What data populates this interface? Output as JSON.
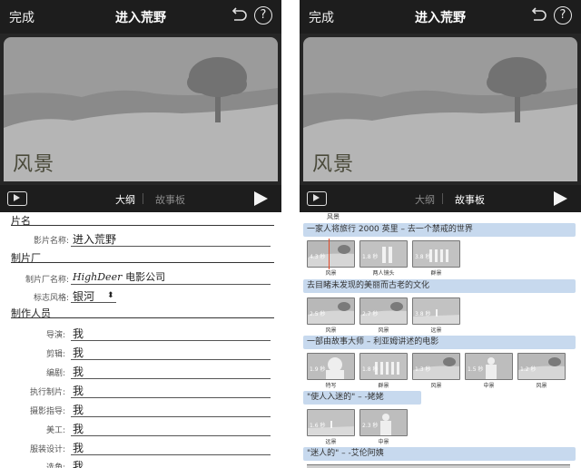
{
  "left": {
    "topbar": {
      "done": "完成",
      "title": "进入荒野",
      "help": "?"
    },
    "preview": {
      "scene_title": "风景"
    },
    "controlbar": {
      "tab_outline": "大纲",
      "tab_storyboard": "故事板"
    },
    "sections": {
      "title": "片名",
      "studio": "制片厂",
      "crew": "制作人员"
    },
    "fields": {
      "movie_name_label": "影片名称:",
      "movie_name_value": "进入荒野",
      "studio_name_label": "制片厂名称:",
      "studio_script": "HighDeer",
      "studio_suffix": "电影公司",
      "logo_label": "标志风格:",
      "logo_value": "银河",
      "crew": [
        {
          "label": "导演:",
          "value": "我"
        },
        {
          "label": "剪辑:",
          "value": "我"
        },
        {
          "label": "编剧:",
          "value": "我"
        },
        {
          "label": "执行制片:",
          "value": "我"
        },
        {
          "label": "摄影指导:",
          "value": "我"
        },
        {
          "label": "美工:",
          "value": "我"
        },
        {
          "label": "服装设计:",
          "value": "我"
        },
        {
          "label": "选角:",
          "value": "我"
        }
      ]
    }
  },
  "right": {
    "topbar": {
      "done": "完成",
      "title": "进入荒野",
      "help": "?"
    },
    "preview": {
      "scene_title": "风景"
    },
    "controlbar": {
      "tab_outline": "大纲",
      "tab_storyboard": "故事板"
    },
    "top_label": "风景",
    "groups": [
      {
        "heading": "一家人将旅行 2000 英里 – 去一个禁戒的世界",
        "clips": [
          {
            "duration": "4.3 秒",
            "label": "风景"
          },
          {
            "duration": "1.8 秒",
            "label": "两人镜头"
          },
          {
            "duration": "3.8 秒",
            "label": "群景"
          }
        ]
      },
      {
        "heading": "去目睹未发现的美丽而古老的文化",
        "clips": [
          {
            "duration": "2.5 秒",
            "label": "风景"
          },
          {
            "duration": "2.7 秒",
            "label": "风景"
          },
          {
            "duration": "3.8 秒",
            "label": "远景"
          }
        ]
      },
      {
        "heading": "一部由故事大师 – 利亚姆讲述的电影",
        "clips": [
          {
            "duration": "1.9 秒",
            "label": "特写"
          },
          {
            "duration": "1.8 秒",
            "label": "群景"
          },
          {
            "duration": "1.3 秒",
            "label": "风景"
          },
          {
            "duration": "1.5 秒",
            "label": "中景"
          },
          {
            "duration": "1.2 秒",
            "label": "风景"
          }
        ]
      },
      {
        "heading": "\"使人入迷的\" – -姥姥",
        "clips": [
          {
            "duration": "1.6 秒",
            "label": "远景"
          },
          {
            "duration": "2.3 秒",
            "label": "中景"
          }
        ]
      },
      {
        "heading": "\"迷人的\" – -艾伦阿姨",
        "clips": []
      }
    ]
  },
  "colors": {
    "bar": "#1d1d1d",
    "heading_highlight": "#c7d9ee",
    "playhead": "#e04a2a"
  }
}
